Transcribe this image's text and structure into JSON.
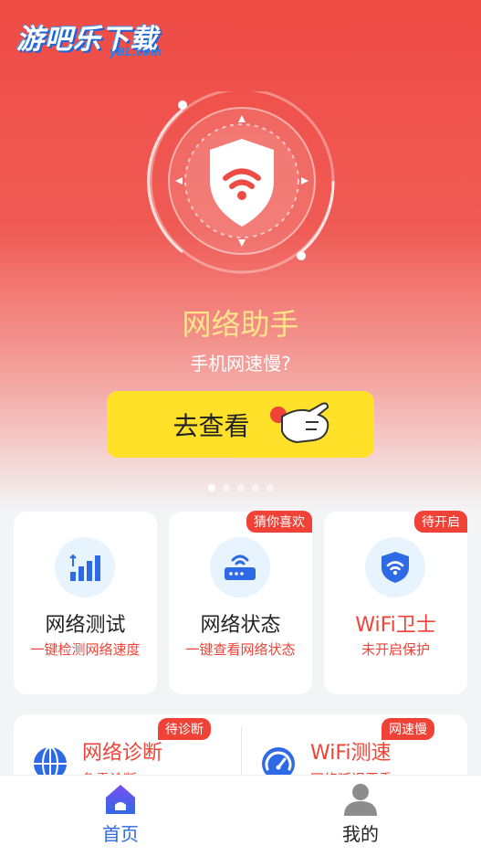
{
  "watermark": {
    "brand": "游吧乐下载",
    "domain": "yBL.com"
  },
  "hero": {
    "title": "网络助手",
    "subtitle": "手机网速慢?",
    "cta_label": "去查看",
    "carousel_count": 5,
    "carousel_active": 0
  },
  "cards": [
    {
      "title": "网络测试",
      "desc": "一键检测网络速度",
      "badge": "",
      "icon": "bar-chart-icon"
    },
    {
      "title": "网络状态",
      "desc": "一键查看网络状态",
      "badge": "猜你喜欢",
      "icon": "router-icon"
    },
    {
      "title": "WiFi卫士",
      "desc": "未开启保护",
      "badge": "待开启",
      "icon": "wifi-shield-icon"
    }
  ],
  "panel": [
    {
      "title": "网络诊断",
      "desc": "急需诊断",
      "badge": "待诊断",
      "icon": "globe-icon"
    },
    {
      "title": "WiFi测速",
      "desc": "网络延迟严重",
      "badge": "网速慢",
      "icon": "speedometer-icon"
    }
  ],
  "tabbar": [
    {
      "label": "首页",
      "icon": "home-icon",
      "active": true
    },
    {
      "label": "我的",
      "icon": "user-icon",
      "active": false
    }
  ],
  "colors": {
    "hero_red": "#ef4b45",
    "accent_red": "#f04236",
    "cta_yellow": "#ffe12a",
    "active_blue": "#2e6ae6"
  }
}
